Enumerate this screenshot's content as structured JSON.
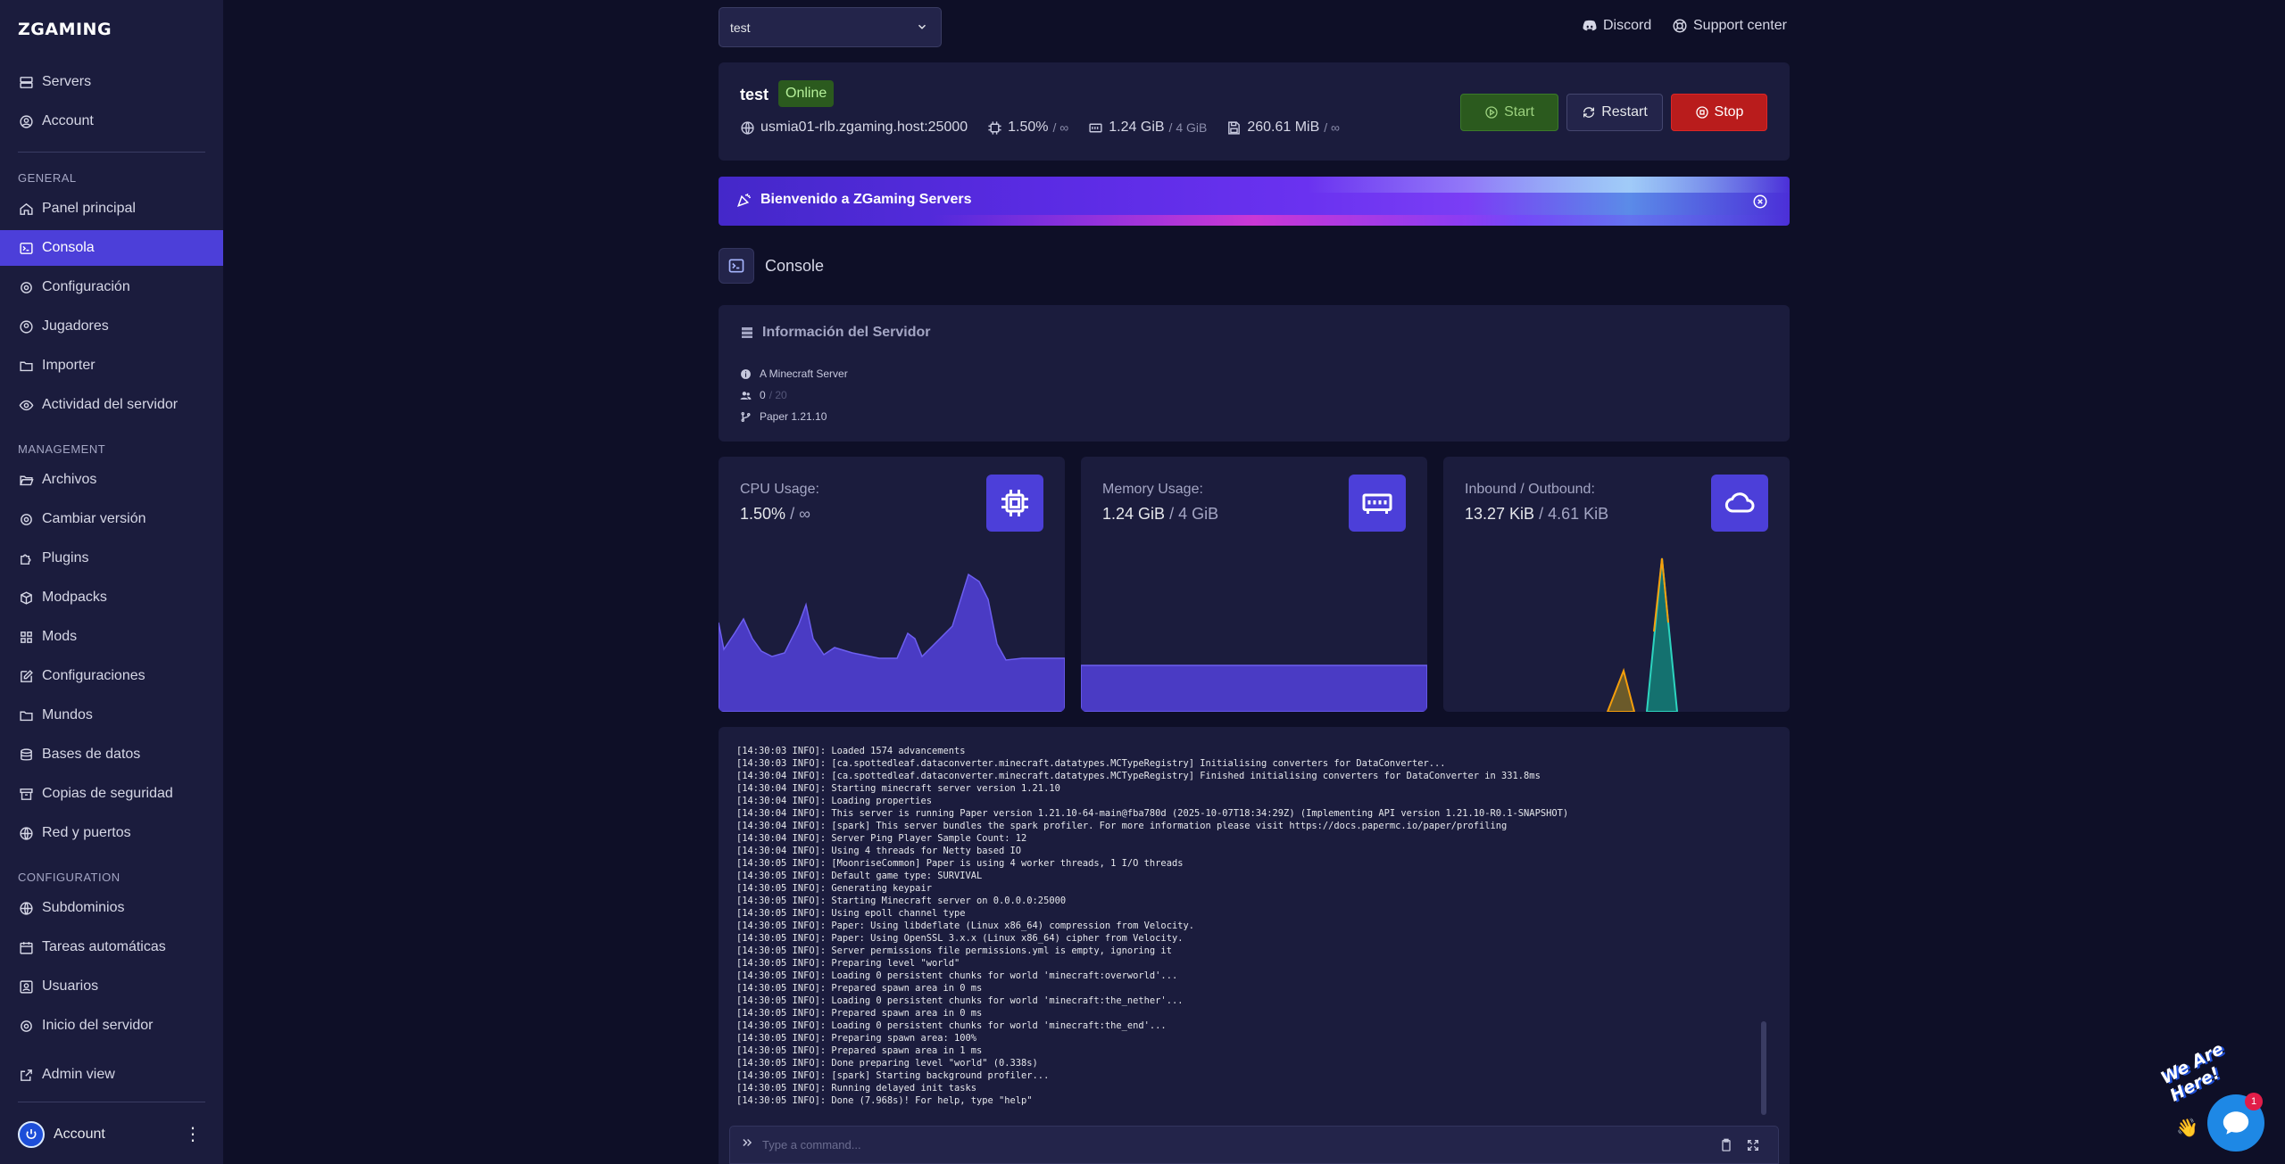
{
  "app": {
    "logo": "ZGAMING"
  },
  "sidebar": {
    "top_items": [
      {
        "label": "Servers",
        "icon": "server-icon"
      },
      {
        "label": "Account",
        "icon": "user-circle-icon"
      }
    ],
    "sections": [
      {
        "title": "GENERAL",
        "items": [
          {
            "label": "Panel principal",
            "icon": "home-icon"
          },
          {
            "label": "Consola",
            "icon": "terminal-icon",
            "active": true
          },
          {
            "label": "Configuración",
            "icon": "gear-icon"
          },
          {
            "label": "Jugadores",
            "icon": "users-icon"
          },
          {
            "label": "Importer",
            "icon": "folder-icon"
          },
          {
            "label": "Actividad del servidor",
            "icon": "eye-icon"
          }
        ]
      },
      {
        "title": "MANAGEMENT",
        "items": [
          {
            "label": "Archivos",
            "icon": "folder-open-icon"
          },
          {
            "label": "Cambiar versión",
            "icon": "gear-icon"
          },
          {
            "label": "Plugins",
            "icon": "puzzle-icon"
          },
          {
            "label": "Modpacks",
            "icon": "box-icon"
          },
          {
            "label": "Mods",
            "icon": "grid-icon"
          },
          {
            "label": "Configuraciones",
            "icon": "edit-icon"
          },
          {
            "label": "Mundos",
            "icon": "folder-icon"
          },
          {
            "label": "Bases de datos",
            "icon": "database-icon"
          },
          {
            "label": "Copias de seguridad",
            "icon": "archive-icon"
          },
          {
            "label": "Red y puertos",
            "icon": "globe-icon"
          }
        ]
      },
      {
        "title": "CONFIGURATION",
        "items": [
          {
            "label": "Subdominios",
            "icon": "globe-icon"
          },
          {
            "label": "Tareas automáticas",
            "icon": "calendar-icon"
          },
          {
            "label": "Usuarios",
            "icon": "user-icon"
          },
          {
            "label": "Inicio del servidor",
            "icon": "gear-icon"
          }
        ]
      }
    ],
    "admin_view": "Admin view",
    "account_label": "Account"
  },
  "topbar": {
    "server_select": "test",
    "discord": "Discord",
    "support": "Support center"
  },
  "server": {
    "name": "test",
    "status": "Online",
    "address": "usmia01-rlb.zgaming.host:25000",
    "cpu": "1.50%",
    "cpu_limit": "/ ∞",
    "memory": "1.24 GiB",
    "memory_limit": "/ 4 GiB",
    "disk": "260.61 MiB",
    "disk_limit": "/ ∞",
    "buttons": {
      "start": "Start",
      "restart": "Restart",
      "stop": "Stop"
    },
    "colors": {
      "online": "#2b5a1e",
      "stop": "#b91c1c",
      "accent": "#4c3fd9"
    }
  },
  "banner": {
    "text": "Bienvenido a ZGaming Servers"
  },
  "console": {
    "title": "Console"
  },
  "info": {
    "title": "Información del Servidor",
    "motd": "A Minecraft Server",
    "players_online": "0",
    "players_max": "/ 20",
    "version": "Paper 1.21.10"
  },
  "stats": {
    "cpu": {
      "label": "CPU Usage:",
      "value": "1.50%",
      "sub": "/ ∞"
    },
    "memory": {
      "label": "Memory Usage:",
      "value": "1.24 GiB",
      "sub": "/ 4 GiB"
    },
    "network": {
      "label": "Inbound / Outbound:",
      "value": "13.27 KiB",
      "sub": "/ 4.61 KiB"
    }
  },
  "terminal": {
    "lines": [
      "[14:30:03 INFO]: Loaded 1574 advancements",
      "[14:30:03 INFO]: [ca.spottedleaf.dataconverter.minecraft.datatypes.MCTypeRegistry] Initialising converters for DataConverter...",
      "[14:30:04 INFO]: [ca.spottedleaf.dataconverter.minecraft.datatypes.MCTypeRegistry] Finished initialising converters for DataConverter in 331.8ms",
      "[14:30:04 INFO]: Starting minecraft server version 1.21.10",
      "[14:30:04 INFO]: Loading properties",
      "[14:30:04 INFO]: This server is running Paper version 1.21.10-64-main@fba780d (2025-10-07T18:34:29Z) (Implementing API version 1.21.10-R0.1-SNAPSHOT)",
      "[14:30:04 INFO]: [spark] This server bundles the spark profiler. For more information please visit https://docs.papermc.io/paper/profiling",
      "[14:30:04 INFO]: Server Ping Player Sample Count: 12",
      "[14:30:04 INFO]: Using 4 threads for Netty based IO",
      "[14:30:05 INFO]: [MoonriseCommon] Paper is using 4 worker threads, 1 I/O threads",
      "[14:30:05 INFO]: Default game type: SURVIVAL",
      "[14:30:05 INFO]: Generating keypair",
      "[14:30:05 INFO]: Starting Minecraft server on 0.0.0.0:25000",
      "[14:30:05 INFO]: Using epoll channel type",
      "[14:30:05 INFO]: Paper: Using libdeflate (Linux x86_64) compression from Velocity.",
      "[14:30:05 INFO]: Paper: Using OpenSSL 3.x.x (Linux x86_64) cipher from Velocity.",
      "[14:30:05 INFO]: Server permissions file permissions.yml is empty, ignoring it",
      "[14:30:05 INFO]: Preparing level \"world\"",
      "[14:30:05 INFO]: Loading 0 persistent chunks for world 'minecraft:overworld'...",
      "[14:30:05 INFO]: Prepared spawn area in 0 ms",
      "[14:30:05 INFO]: Loading 0 persistent chunks for world 'minecraft:the_nether'...",
      "[14:30:05 INFO]: Prepared spawn area in 0 ms",
      "[14:30:05 INFO]: Loading 0 persistent chunks for world 'minecraft:the_end'...",
      "[14:30:05 INFO]: Preparing spawn area: 100%",
      "[14:30:05 INFO]: Prepared spawn area in 1 ms",
      "[14:30:05 INFO]: Done preparing level \"world\" (0.338s)",
      "[14:30:05 INFO]: [spark] Starting background profiler...",
      "[14:30:05 INFO]: Running delayed init tasks",
      "[14:30:05 INFO]: Done (7.968s)! For help, type \"help\""
    ],
    "placeholder": "Type a command..."
  },
  "chat_widget": {
    "text": "We Are Here!",
    "badge": "1"
  }
}
